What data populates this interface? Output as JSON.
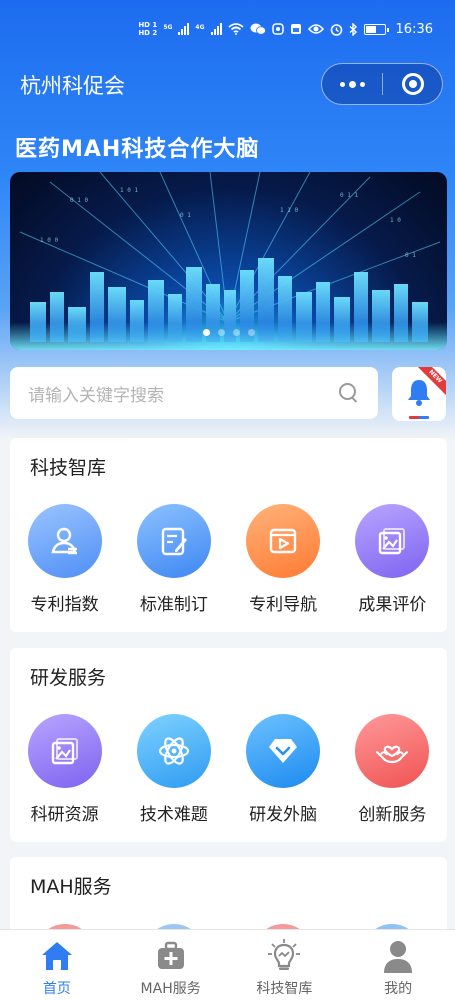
{
  "status_bar": {
    "time": "16:36",
    "hd_top": "HD 1",
    "hd_bottom": "HD 2",
    "net_5g": "5G",
    "net_4g": "4G"
  },
  "nav": {
    "title": "杭州科促会"
  },
  "page_heading": "医药MAH科技合作大脑",
  "banner": {
    "slide_count": 4,
    "active_index": 0
  },
  "search": {
    "placeholder": "请输入关键字搜索"
  },
  "notify": {
    "badge": "NEW"
  },
  "sections": [
    {
      "title": "科技智库",
      "items": [
        {
          "label": "专利指数",
          "icon": "user-icon",
          "color": "#5b97f7"
        },
        {
          "label": "标准制订",
          "icon": "edit-document-icon",
          "color": "#4a90f4"
        },
        {
          "label": "专利导航",
          "icon": "video-play-icon",
          "color": "#ff8a45"
        },
        {
          "label": "成果评价",
          "icon": "image-frame-icon",
          "color": "#8b73f2"
        }
      ]
    },
    {
      "title": "研发服务",
      "items": [
        {
          "label": "科研资源",
          "icon": "image-frame-icon",
          "color": "#8b73f2"
        },
        {
          "label": "技术难题",
          "icon": "atom-icon",
          "color": "#3da3f5"
        },
        {
          "label": "研发外脑",
          "icon": "diamond-icon",
          "color": "#2a90f2"
        },
        {
          "label": "创新服务",
          "icon": "heart-hands-icon",
          "color": "#f26464"
        }
      ]
    },
    {
      "title": "MAH服务"
    }
  ],
  "tab_bar": {
    "tabs": [
      {
        "label": "首页",
        "icon": "home-icon",
        "active": true
      },
      {
        "label": "MAH服务",
        "icon": "medical-kit-icon",
        "active": false
      },
      {
        "label": "科技智库",
        "icon": "lightbulb-icon",
        "active": false
      },
      {
        "label": "我的",
        "icon": "person-icon",
        "active": false
      }
    ]
  },
  "colors": {
    "primary": "#2f7cf3",
    "header_blue": "#1d6cf0",
    "background": "#f2f4f7"
  }
}
